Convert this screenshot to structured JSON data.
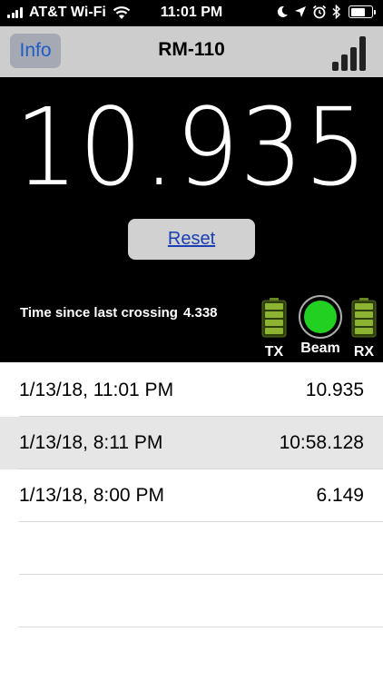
{
  "status_bar": {
    "carrier": "AT&T Wi-Fi",
    "time": "11:01 PM",
    "icons": [
      "signal-bars-icon",
      "wifi-icon",
      "moon-icon",
      "location-arrow-icon",
      "alarm-icon",
      "bluetooth-icon",
      "battery-icon"
    ]
  },
  "nav": {
    "info_label": "Info",
    "title": "RM-110",
    "signal_icon": "signal-strength-icon"
  },
  "panel": {
    "reading": "10.935",
    "reset_label": "Reset",
    "time_since_label": "Time since last crossing",
    "time_since_value": "4.338",
    "indicators": {
      "tx_label": "TX",
      "beam_label": "Beam",
      "rx_label": "RX",
      "beam_color": "#21d021",
      "battery_color": "#7fa52b"
    }
  },
  "list": {
    "rows": [
      {
        "date": "1/13/18, 11:01 PM",
        "value": "10.935"
      },
      {
        "date": "1/13/18, 8:11 PM",
        "value": "10:58.128"
      },
      {
        "date": "1/13/18, 8:00 PM",
        "value": "6.149"
      }
    ]
  }
}
